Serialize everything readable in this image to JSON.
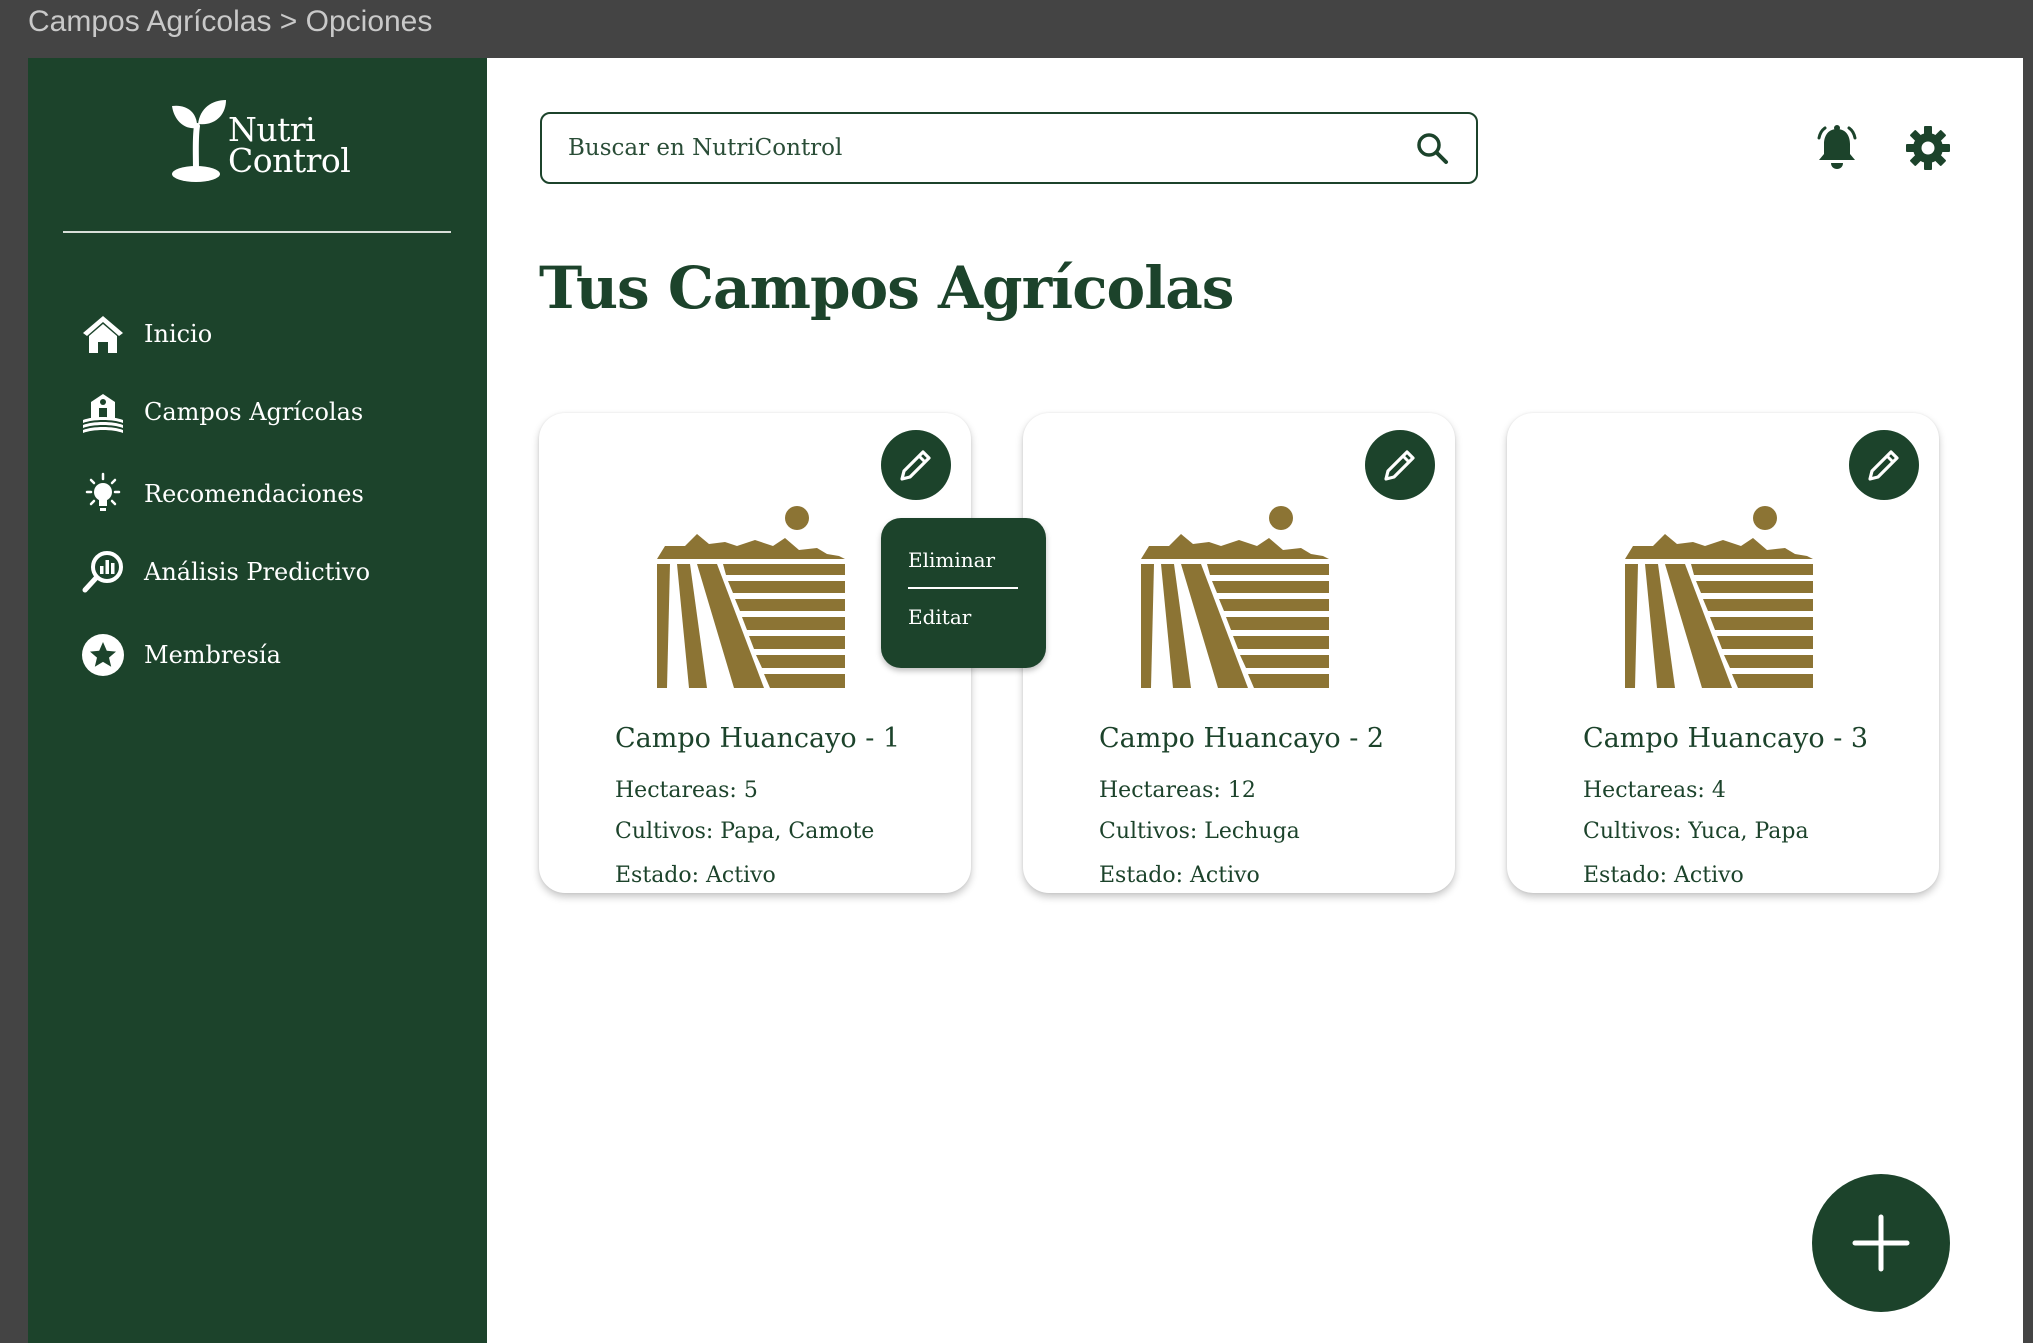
{
  "breadcrumb": "Campos Agrícolas > Opciones",
  "brand": {
    "line1": "Nutri",
    "line2": "Control"
  },
  "sidebar": {
    "items": [
      {
        "label": "Inicio",
        "icon": "home-icon"
      },
      {
        "label": "Campos Agrícolas",
        "icon": "farm-icon"
      },
      {
        "label": "Recomendaciones",
        "icon": "lightbulb-icon"
      },
      {
        "label": "Análisis Predictivo",
        "icon": "analytics-icon"
      },
      {
        "label": "Membresía",
        "icon": "star-icon"
      }
    ]
  },
  "search": {
    "placeholder": "Buscar en NutriControl",
    "icon": "search-icon"
  },
  "header": {
    "notification_icon": "bell-icon",
    "settings_icon": "gear-icon"
  },
  "page_title": "Tus Campos Agrícolas",
  "fields": [
    {
      "name": "Campo Huancayo - 1",
      "hectares": "Hectareas: 5",
      "crops": "Cultivos: Papa, Camote",
      "status": "Estado: Activo"
    },
    {
      "name": "Campo Huancayo - 2",
      "hectares": "Hectareas: 12",
      "crops": "Cultivos: Lechuga",
      "status": "Estado: Activo"
    },
    {
      "name": "Campo Huancayo - 3",
      "hectares": "Hectareas: 4",
      "crops": "Cultivos: Yuca, Papa",
      "status": "Estado: Activo"
    }
  ],
  "options_menu": {
    "delete_label": "Eliminar",
    "edit_label": "Editar"
  },
  "fab_icon": "plus-icon",
  "colors": {
    "primary": "#1c432b",
    "accent": "#8c7434",
    "background": "#ffffff",
    "chrome": "#444444"
  }
}
